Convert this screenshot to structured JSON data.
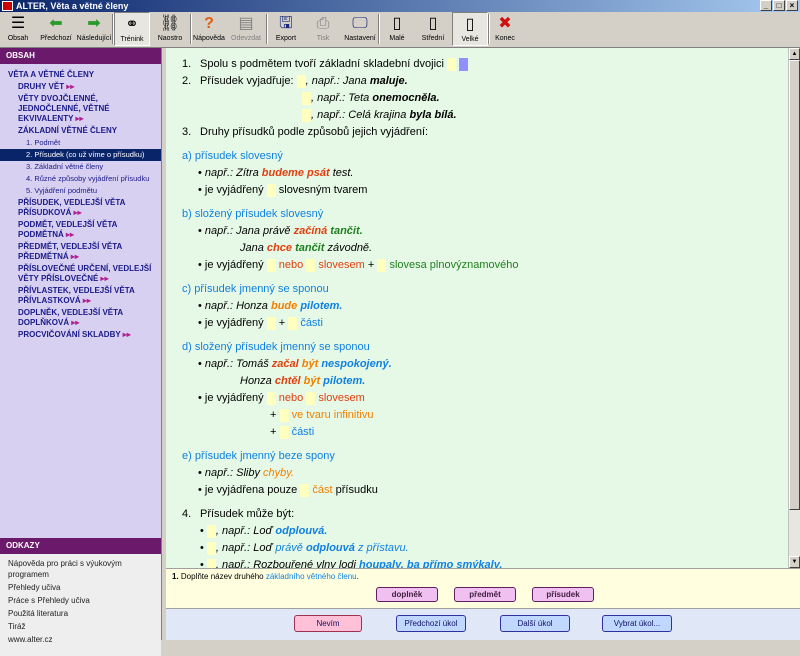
{
  "window": {
    "title": "ALTER, Věta a větné členy",
    "buttons": [
      "_",
      "□",
      "×"
    ]
  },
  "toolbar": [
    {
      "name": "obsah",
      "label": "Obsah",
      "icon": "list-icon",
      "glyph": "☰",
      "state": "normal"
    },
    {
      "name": "predchozi",
      "label": "Předchozí",
      "icon": "arrow-left-icon",
      "glyph": "⬅",
      "state": "normal"
    },
    {
      "name": "nasledujici",
      "label": "Následující",
      "icon": "arrow-right-icon",
      "glyph": "➡",
      "state": "normal"
    },
    {
      "name": "trenink",
      "label": "Trénink",
      "icon": "training-icon",
      "glyph": "⚭",
      "state": "pressed"
    },
    {
      "name": "naostro",
      "label": "Naostro",
      "icon": "chain-icon",
      "glyph": "⛓",
      "state": "normal"
    },
    {
      "name": "napoveda",
      "label": "Nápověda",
      "icon": "question-icon",
      "glyph": "?",
      "state": "normal"
    },
    {
      "name": "odevzdat",
      "label": "Odevzdat",
      "icon": "submit-icon",
      "glyph": "▤",
      "state": "disabled"
    },
    {
      "name": "export",
      "label": "Export",
      "icon": "export-icon",
      "glyph": "🖫",
      "state": "normal"
    },
    {
      "name": "tisk",
      "label": "Tisk",
      "icon": "printer-icon",
      "glyph": "⎙",
      "state": "disabled"
    },
    {
      "name": "nastaveni",
      "label": "Nastavení",
      "icon": "monitor-icon",
      "glyph": "🖵",
      "state": "normal"
    },
    {
      "name": "male",
      "label": "Malé",
      "icon": "page-small-icon",
      "glyph": "▯",
      "state": "normal"
    },
    {
      "name": "stredni",
      "label": "Střední",
      "icon": "page-medium-icon",
      "glyph": "▯",
      "state": "normal"
    },
    {
      "name": "velke",
      "label": "Velké",
      "icon": "page-large-icon",
      "glyph": "▯",
      "state": "pressed"
    },
    {
      "name": "konec",
      "label": "Konec",
      "icon": "close-icon",
      "glyph": "✖",
      "state": "normal"
    }
  ],
  "sidebar": {
    "contents_heading": "OBSAH",
    "nav": [
      {
        "level": 0,
        "text": "VĚTA A VĚTNÉ ČLENY"
      },
      {
        "level": 1,
        "text": "DRUHY VĚT",
        "arrow": "▸▸"
      },
      {
        "level": 1,
        "text": "VĚTY DVOJČLENNÉ, JEDNOČLENNÉ, VĚTNÉ EKVIVALENTY",
        "arrow": "▸▸"
      },
      {
        "level": 1,
        "text": "ZÁKLADNÍ VĚTNÉ ČLENY"
      },
      {
        "level": 2,
        "text": "1. Podmět"
      },
      {
        "level": 2,
        "text": "2. Přísudek (co už víme o přísudku)",
        "selected": true
      },
      {
        "level": 2,
        "text": "3. Základní větné členy"
      },
      {
        "level": 2,
        "text": "4. Různé způsoby vyjádření přísudku"
      },
      {
        "level": 2,
        "text": "5. Vyjádření podmětu"
      },
      {
        "level": 1,
        "text": "PŘÍSUDEK, VEDLEJŠÍ VĚTA PŘÍSUDKOVÁ",
        "arrow": "▸▸"
      },
      {
        "level": 1,
        "text": "PODMĚT, VEDLEJŠÍ VĚTA PODMĚTNÁ",
        "arrow": "▸▸"
      },
      {
        "level": 1,
        "text": "PŘEDMĚT, VEDLEJŠÍ VĚTA PŘEDMĚTNÁ",
        "arrow": "▸▸"
      },
      {
        "level": 1,
        "text": "PŘÍSLOVEČNÉ URČENÍ, VEDLEJŠÍ VĚTY PŘÍSLOVEČNÉ",
        "arrow": "▸▸"
      },
      {
        "level": 1,
        "text": "PŘÍVLASTEK, VEDLEJŠÍ VĚTA PŘÍVLASTKOVÁ",
        "arrow": "▸▸"
      },
      {
        "level": 1,
        "text": "DOPLNĚK, VEDLEJŠÍ VĚTA DOPLŇKOVÁ",
        "arrow": "▸▸"
      },
      {
        "level": 1,
        "text": "PROCVIČOVÁNÍ SKLADBY",
        "arrow": "▸▸"
      }
    ],
    "links_heading": "ODKAZY",
    "links": [
      "Nápověda pro práci s výukovým programem",
      "Přehledy učiva",
      "Práce s Přehledy učiva",
      "Použitá literatura",
      "Tiráž",
      "www.alter.cz"
    ]
  },
  "content": {
    "p1": {
      "num": "1.",
      "text": "Spolu s podmětem tvoří základní skladební dvojici"
    },
    "p2": {
      "num": "2.",
      "lead": "Přísudek vyjadřuje:",
      "ex1a": ", např.: Jana ",
      "ex1b": "maluje.",
      "ex2a": ", např.: Teta ",
      "ex2b": "onemocněla.",
      "ex3a": ", např.: Celá krajina ",
      "ex3b": "byla bílá."
    },
    "p3": {
      "num": "3.",
      "text": "Druhy přísudků podle způsobů jejich vyjádření:"
    },
    "a": {
      "title": "a)  přísudek slovesný",
      "ex_pre": "např.: Zítra ",
      "ex_hl": "budeme psát",
      "ex_post": " test.",
      "how_pre": "je vyjádřený",
      "how_post": "slovesným tvarem"
    },
    "b": {
      "title": "b)  složený přísudek slovesný",
      "ex1_pre": "např.: Jana právě ",
      "ex1_hl1": "začíná",
      "ex1_hl2": "tančit.",
      "ex2_pre": "Jana ",
      "ex2_hl1": "chce",
      "ex2_hl2": "tančit",
      "ex2_post": " závodně.",
      "how_pre": "je vyjádřený",
      "how_w1": "nebo",
      "how_w2": "slovesem",
      "how_plus": "+",
      "how_w3": "slovesa plnovýznamového"
    },
    "c": {
      "title": "c)  přísudek jmenný se sponou",
      "ex_pre": "např.: Honza ",
      "ex_hl1": "bude",
      "ex_hl2": "pilotem.",
      "how_pre": "je vyjádřený",
      "how_plus": "+",
      "how_w": "části"
    },
    "d": {
      "title": "d)  složený přísudek jmenný se sponou",
      "ex1_pre": "např.: Tomáš ",
      "ex1_hl1": "začal",
      "ex1_hl2": "být",
      "ex1_hl3": "nespokojený.",
      "ex2_pre": "Honza ",
      "ex2_hl1": "chtěl",
      "ex2_hl2": "být",
      "ex2_hl3": "pilotem.",
      "how_pre": "je vyjádřený",
      "how_w1": "nebo",
      "how_w2": "slovesem",
      "plus1": "+",
      "inf": "ve tvaru infinitivu",
      "plus2": "+",
      "part": "části"
    },
    "e": {
      "title": "e)  přísudek jmenný beze spony",
      "ex_pre": "např.: Sliby ",
      "ex_hl": "chyby.",
      "how_pre": "je vyjádřena pouze",
      "how_w": "část",
      "how_post": " přísudku"
    },
    "p4": {
      "num": "4.",
      "text": "Přísudek může být:",
      "l1_pre": ", např.: Loď ",
      "l1_hl": "odplouvá.",
      "l2_pre": ", např.: Loď ",
      "l2_hl1": "právě",
      "l2_hl2": "odplouvá",
      "l2_hl3": "z přístavu.",
      "l3_pre": ", např.: Rozbouřené vlny lodi ",
      "l3_hl": "houpaly, ba přímo smýkaly."
    }
  },
  "task": {
    "num": "1.",
    "text_pre": "Doplňte název druhého ",
    "text_hl": "základního větného členu",
    "text_post": ".",
    "answers": [
      "doplněk",
      "předmět",
      "přísudek"
    ]
  },
  "bottom_buttons": [
    "Nevím",
    "Předchozí úkol",
    "Další úkol",
    "Vybrat úkol..."
  ],
  "colors": {
    "title_bar": "#0a246a",
    "sidebar_header": "#6b1a6b",
    "content_bg": "#e6f9e6",
    "highlight_red": "#e04010",
    "highlight_blue": "#1080e0",
    "highlight_green": "#208020",
    "highlight_orange": "#f08000"
  }
}
